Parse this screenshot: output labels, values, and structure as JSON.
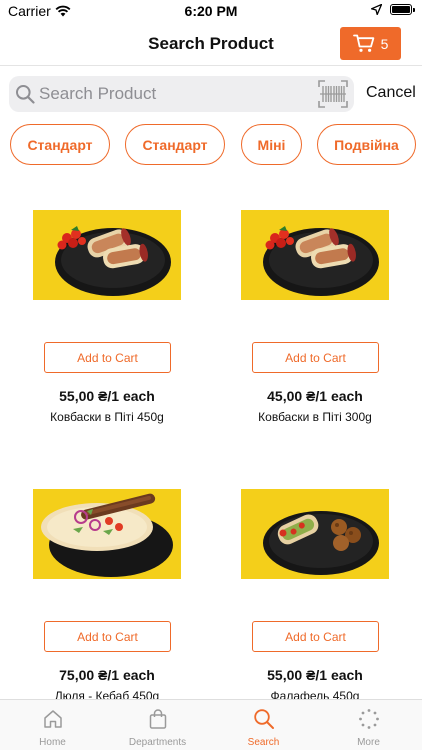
{
  "status": {
    "carrier": "Carrier",
    "time": "6:20 PM"
  },
  "nav": {
    "title": "Search Product",
    "cart_count": "5"
  },
  "search": {
    "placeholder": "Search Product",
    "value": "",
    "cancel_label": "Cancel"
  },
  "filters": [
    "Стандарт",
    "Стандарт",
    "Міні",
    "Подвійна"
  ],
  "products": [
    {
      "price": "55,00 ₴/1 each",
      "name": "Ковбаски в Піті 450g",
      "button": "Add to Cart",
      "image": "wrap-dish"
    },
    {
      "price": "45,00 ₴/1 each",
      "name": "Ковбаски в Піті 300g",
      "button": "Add to Cart",
      "image": "wrap-dish"
    },
    {
      "price": "75,00 ₴/1 each",
      "name": "Люля - Кебаб 450g",
      "button": "Add to Cart",
      "image": "kebab-dish"
    },
    {
      "price": "55,00 ₴/1 each",
      "name": "Фалафель 450g",
      "button": "Add to Cart",
      "image": "falafel-dish"
    }
  ],
  "tabs": [
    {
      "label": "Home",
      "icon": "home-icon"
    },
    {
      "label": "Departments",
      "icon": "bag-icon"
    },
    {
      "label": "Search",
      "icon": "search-icon"
    },
    {
      "label": "More",
      "icon": "more-icon"
    }
  ],
  "active_tab": "Search",
  "colors": {
    "accent": "#ef6a2a",
    "image_background": "#f4cf1a",
    "search_background": "#eeeef0"
  }
}
